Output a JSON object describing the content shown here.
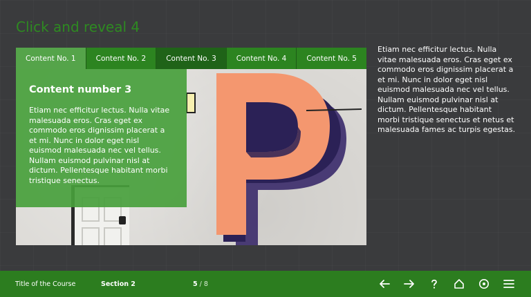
{
  "page": {
    "title": "Click and reveal 4",
    "side_text": "Etiam nec efficitur lectus. Nulla vitae malesuada eros. Cras eget ex commodo eros dignissim placerat a et mi. Nunc in dolor eget nisl euismod malesuada nec vel tellus.  Nullam euismod pulvinar nisl at dictum. Pellentesque habitant morbi tristique senectus et netus et malesuada fames ac turpis egestas."
  },
  "tabs": [
    {
      "label": "Content No. 1"
    },
    {
      "label": "Content No. 2"
    },
    {
      "label": "Content No. 3"
    },
    {
      "label": "Content No. 4"
    },
    {
      "label": "Content No. 5"
    }
  ],
  "reveal": {
    "heading": "Content number 3",
    "body": "Etiam nec efficitur lectus. Nulla vitae malesuada eros. Cras eget ex commodo eros dignissim placerat a et mi. Nunc in dolor eget nisl euismod malesuada nec vel tellus. Nullam euismod pulvinar nisl at dictum. Pellentesque habitant morbi tristique senectus."
  },
  "footer": {
    "course": "Title of the Course",
    "section": "Section 2",
    "current_page": "5",
    "total_pages": "/ 8",
    "icons": [
      "arrow-left-icon",
      "arrow-right-icon",
      "help-icon",
      "home-icon",
      "target-icon",
      "menu-icon"
    ]
  },
  "colors": {
    "background": "#3a3b3d",
    "accent": "#2e8a21",
    "footer": "#2c7d1f",
    "overlay": "#48a03c",
    "letter": "#f4976f"
  }
}
